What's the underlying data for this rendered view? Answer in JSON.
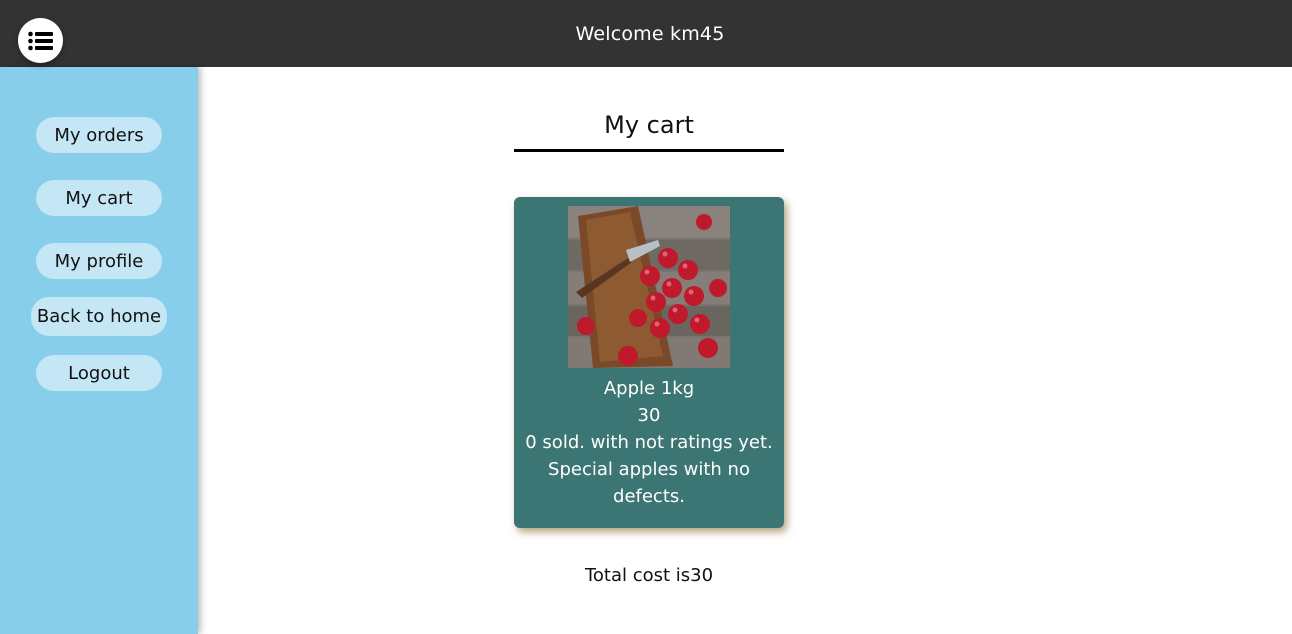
{
  "header": {
    "welcome": "Welcome km45",
    "menu_icon": "list-icon"
  },
  "sidebar": {
    "background": "#87ceeb",
    "items": [
      {
        "label": "My orders"
      },
      {
        "label": "My cart"
      },
      {
        "label": "My profile"
      },
      {
        "label": "Back to home"
      },
      {
        "label": "Logout"
      }
    ]
  },
  "main": {
    "title": "My cart",
    "cart_items": [
      {
        "image": "apples-photo",
        "name": "Apple 1kg",
        "price": "30",
        "sales_info": "0 sold. with not ratings yet.",
        "description": "Special apples with no defects."
      }
    ],
    "total": "Total cost is30"
  },
  "colors": {
    "topbar": "#333333",
    "card": "#3b7574",
    "button": "#c5e6f5"
  }
}
